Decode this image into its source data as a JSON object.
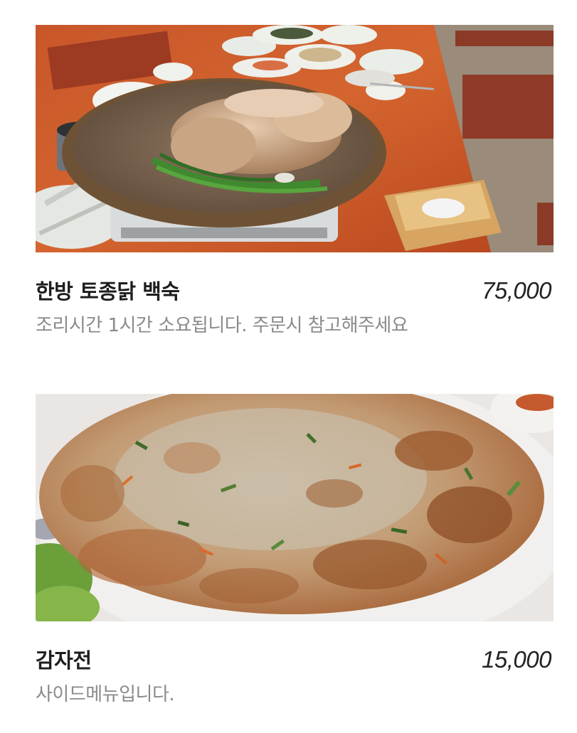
{
  "menu": {
    "items": [
      {
        "name": "한방 토종닭 백숙",
        "price": "75,000",
        "description": "조리시간 1시간 소요됩니다. 주문시 참고해주세요",
        "image": "herbal-chicken-soup-photo"
      },
      {
        "name": "감자전",
        "price": "15,000",
        "description": "사이드메뉴입니다.",
        "image": "potato-pancake-photo"
      }
    ]
  }
}
